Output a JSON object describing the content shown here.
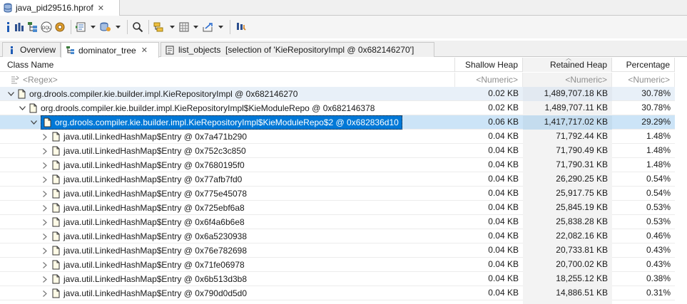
{
  "editor": {
    "tab_title": "java_pid29516.hprof",
    "close_glyph": "✕"
  },
  "toolbar": {
    "icons": [
      "info-icon",
      "histogram-icon",
      "dominator-tree-icon",
      "oql-icon",
      "heap-dump-overview-icon",
      "run-report-icon",
      "query-browser-icon",
      "search-icon",
      "group-by-icon",
      "calculate-retained-size-icon",
      "export-icon",
      "pin-icon"
    ]
  },
  "view_tabs": [
    {
      "label": "Overview",
      "active": false,
      "closable": false
    },
    {
      "label": "dominator_tree",
      "active": true,
      "closable": true
    },
    {
      "label": "list_objects  [selection of 'KieRepositoryImpl @ 0x682146270']",
      "active": false,
      "closable": false
    }
  ],
  "columns": {
    "class_name": "Class Name",
    "shallow_heap": "Shallow Heap",
    "retained_heap": "Retained Heap",
    "percentage": "Percentage"
  },
  "filter": {
    "class_name": "<Regex>",
    "shallow_heap": "<Numeric>",
    "retained_heap": "<Numeric>",
    "percentage": "<Numeric>"
  },
  "rows": [
    {
      "depth": 0,
      "expanded": true,
      "name": "org.drools.compiler.kie.builder.impl.KieRepositoryImpl @ 0x682146270",
      "shallow": "0.02 KB",
      "retained": "1,489,707.18 KB",
      "pct": "30.78%",
      "state": "parent"
    },
    {
      "depth": 1,
      "expanded": true,
      "name": "org.drools.compiler.kie.builder.impl.KieRepositoryImpl$KieModuleRepo @ 0x682146378",
      "shallow": "0.02 KB",
      "retained": "1,489,707.11 KB",
      "pct": "30.78%",
      "state": "normal"
    },
    {
      "depth": 2,
      "expanded": true,
      "name": "org.drools.compiler.kie.builder.impl.KieRepositoryImpl$KieModuleRepo$2 @ 0x682836d10",
      "shallow": "0.06 KB",
      "retained": "1,417,717.02 KB",
      "pct": "29.29%",
      "state": "selected"
    },
    {
      "depth": 3,
      "expanded": false,
      "name": "java.util.LinkedHashMap$Entry @ 0x7a471b290",
      "shallow": "0.04 KB",
      "retained": "71,792.44 KB",
      "pct": "1.48%",
      "state": "normal"
    },
    {
      "depth": 3,
      "expanded": false,
      "name": "java.util.LinkedHashMap$Entry @ 0x752c3c850",
      "shallow": "0.04 KB",
      "retained": "71,790.49 KB",
      "pct": "1.48%",
      "state": "normal"
    },
    {
      "depth": 3,
      "expanded": false,
      "name": "java.util.LinkedHashMap$Entry @ 0x7680195f0",
      "shallow": "0.04 KB",
      "retained": "71,790.31 KB",
      "pct": "1.48%",
      "state": "normal"
    },
    {
      "depth": 3,
      "expanded": false,
      "name": "java.util.LinkedHashMap$Entry @ 0x77afb7fd0",
      "shallow": "0.04 KB",
      "retained": "26,290.25 KB",
      "pct": "0.54%",
      "state": "normal"
    },
    {
      "depth": 3,
      "expanded": false,
      "name": "java.util.LinkedHashMap$Entry @ 0x775e45078",
      "shallow": "0.04 KB",
      "retained": "25,917.75 KB",
      "pct": "0.54%",
      "state": "normal"
    },
    {
      "depth": 3,
      "expanded": false,
      "name": "java.util.LinkedHashMap$Entry @ 0x725ebf6a8",
      "shallow": "0.04 KB",
      "retained": "25,845.19 KB",
      "pct": "0.53%",
      "state": "normal"
    },
    {
      "depth": 3,
      "expanded": false,
      "name": "java.util.LinkedHashMap$Entry @ 0x6f4a6b6e8",
      "shallow": "0.04 KB",
      "retained": "25,838.28 KB",
      "pct": "0.53%",
      "state": "normal"
    },
    {
      "depth": 3,
      "expanded": false,
      "name": "java.util.LinkedHashMap$Entry @ 0x6a5230938",
      "shallow": "0.04 KB",
      "retained": "22,082.16 KB",
      "pct": "0.46%",
      "state": "normal"
    },
    {
      "depth": 3,
      "expanded": false,
      "name": "java.util.LinkedHashMap$Entry @ 0x76e782698",
      "shallow": "0.04 KB",
      "retained": "20,733.81 KB",
      "pct": "0.43%",
      "state": "normal"
    },
    {
      "depth": 3,
      "expanded": false,
      "name": "java.util.LinkedHashMap$Entry @ 0x71fe06978",
      "shallow": "0.04 KB",
      "retained": "20,700.02 KB",
      "pct": "0.43%",
      "state": "normal"
    },
    {
      "depth": 3,
      "expanded": false,
      "name": "java.util.LinkedHashMap$Entry @ 0x6b513d3b8",
      "shallow": "0.04 KB",
      "retained": "18,255.12 KB",
      "pct": "0.38%",
      "state": "normal"
    },
    {
      "depth": 3,
      "expanded": false,
      "name": "java.util.LinkedHashMap$Entry @ 0x790d0d5d0",
      "shallow": "0.04 KB",
      "retained": "14,886.51 KB",
      "pct": "0.31%",
      "state": "normal"
    },
    {
      "depth": 3,
      "expanded": false,
      "name": "",
      "shallow": "",
      "retained": "",
      "pct": "",
      "state": "normal"
    }
  ],
  "colors": {
    "selection": "#0078d7",
    "selection_row": "#cce4f7",
    "header_sorted_bg": "#f3f3f3"
  }
}
